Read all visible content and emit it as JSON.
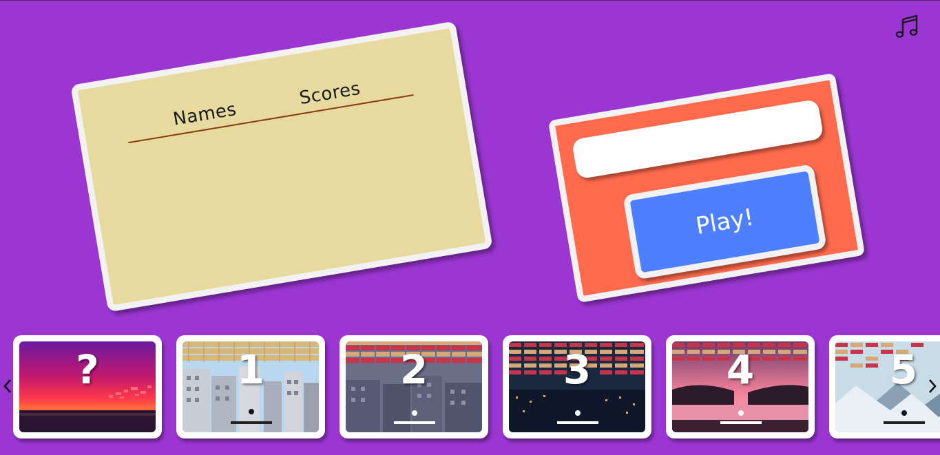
{
  "music": {
    "icon": "music-note-icon"
  },
  "scoreboard": {
    "columns": {
      "names": "Names",
      "scores": "Scores"
    },
    "rows": []
  },
  "play_form": {
    "name_value": "",
    "play_label": "Play!"
  },
  "levels": [
    {
      "label": "?",
      "theme": "sunset"
    },
    {
      "label": "1",
      "theme": "city-day"
    },
    {
      "label": "2",
      "theme": "city-grey"
    },
    {
      "label": "3",
      "theme": "city-night"
    },
    {
      "label": "4",
      "theme": "lake-pink"
    },
    {
      "label": "5",
      "theme": "snow-mountain"
    }
  ],
  "colors": {
    "background": "#9b36d2",
    "scoreboard": "#e7da9f",
    "play_card": "#ff6a4d",
    "play_button": "#4d7fff"
  },
  "nav": {
    "prev_icon": "chevron-left-icon",
    "next_icon": "chevron-right-icon"
  }
}
